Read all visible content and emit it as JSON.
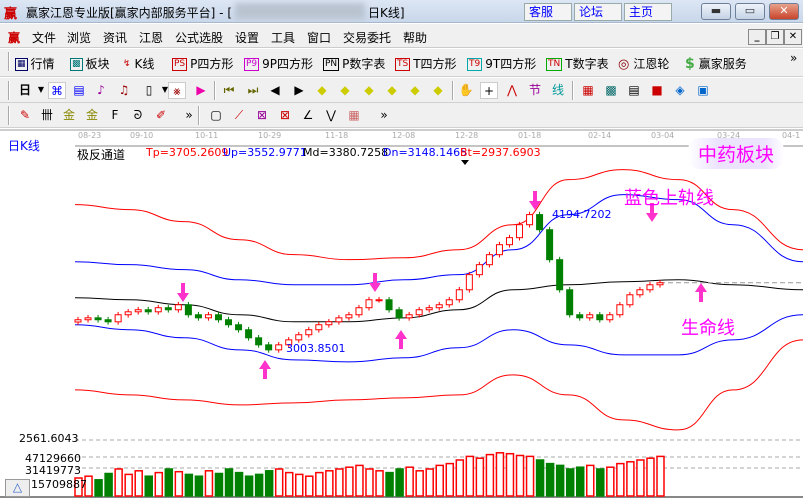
{
  "window": {
    "logo": "赢",
    "title": "赢家江恩专业版[赢家内部服务平台] - [",
    "title_tail": "日K线]",
    "links": [
      "客服",
      "论坛",
      "主页"
    ],
    "controls": [
      "minimize",
      "maximize",
      "close"
    ]
  },
  "menu": {
    "logo": "赢",
    "items": [
      "文件",
      "浏览",
      "资讯",
      "江恩",
      "公式选股",
      "设置",
      "工具",
      "窗口",
      "交易委托",
      "帮助"
    ]
  },
  "toolbar1": {
    "items": [
      {
        "icon": "quote-table-icon",
        "glyph": "▦",
        "label": "行情"
      },
      {
        "icon": "sector-icon",
        "glyph": "▩",
        "label": "板块"
      },
      {
        "icon": "candlestick-icon",
        "glyph": "↯",
        "label": "K线"
      },
      {
        "icon": "ps-icon",
        "glyph": "PS",
        "label": "P四方形"
      },
      {
        "icon": "p9-icon",
        "glyph": "P9",
        "label": "9P四方形"
      },
      {
        "icon": "pn-icon",
        "glyph": "PN",
        "label": "P数字表"
      },
      {
        "icon": "ts-icon",
        "glyph": "TS",
        "label": "T四方形"
      },
      {
        "icon": "t9-icon",
        "glyph": "T9",
        "label": "9T四方形"
      },
      {
        "icon": "tn-icon",
        "glyph": "TN",
        "label": "T数字表"
      },
      {
        "icon": "gann-wheel-icon",
        "glyph": "◎",
        "label": "江恩轮"
      },
      {
        "icon": "dollar-icon",
        "glyph": "$",
        "label": "赢家服务"
      }
    ],
    "more": "»"
  },
  "toolbar2": {
    "period": "日",
    "more": "»"
  },
  "toolbar3": {
    "more": "»"
  },
  "chart": {
    "period_label": "日K线",
    "dates": [
      "08-23",
      "09-10",
      "10-11",
      "10-29",
      "11-18",
      "12-08",
      "12-28",
      "01-18",
      "02-14",
      "03-04",
      "03-24",
      "04-1"
    ],
    "indicator": {
      "name": "极反通道",
      "tp": "Tp=3705.2609",
      "up": "Up=3552.9771",
      "md": "Md=3380.7258",
      "dn": "Dn=3148.1465",
      "bt": "Bt=2937.6903"
    },
    "sector_badge": "中药板块",
    "annot_upper": "蓝色上轨线",
    "annot_life": "生命线",
    "high_label": "4194.7202",
    "low_label": "3003.8501",
    "volume_labels": [
      "2561.6043",
      "47129660",
      "31419773",
      "15709887"
    ],
    "volume_button": "△",
    "colors": {
      "up": "#ff0000",
      "down": "#008000",
      "tp": "#ff0000",
      "upper": "#0000ff",
      "mid": "#000000",
      "arrow": "#ff33cc"
    }
  },
  "chart_data": {
    "type": "line",
    "ylim": [
      2280,
      4790
    ],
    "line_x_fraction": [
      0,
      0.075,
      0.15,
      0.226,
      0.301,
      0.376,
      0.452,
      0.527,
      0.602,
      0.678,
      0.753,
      0.829,
      0.904,
      1
    ],
    "series": [
      {
        "name": "Tp",
        "values": [
          4265,
          4221,
          4115,
          3956,
          3824,
          3780,
          3797,
          3868,
          4088,
          4485,
          4573,
          4485,
          4221,
          3868
        ]
      },
      {
        "name": "Up",
        "values": [
          3762,
          3736,
          3692,
          3603,
          3559,
          3559,
          3603,
          3648,
          3868,
          4177,
          4353,
          4309,
          4088,
          3762
        ]
      },
      {
        "name": "Md",
        "values": [
          3445,
          3427,
          3383,
          3295,
          3233,
          3233,
          3268,
          3339,
          3515,
          3559,
          3586,
          3603,
          3559,
          3515
        ]
      },
      {
        "name": "Dn",
        "values": [
          3207,
          3163,
          3092,
          2986,
          2898,
          2880,
          2916,
          3004,
          3163,
          3030,
          2942,
          2942,
          3074,
          3295
        ]
      },
      {
        "name": "Bt",
        "values": [
          2633,
          2589,
          2545,
          2501,
          2519,
          2545,
          2563,
          2589,
          2766,
          2589,
          2369,
          2281,
          2633,
          3074
        ]
      }
    ],
    "closes": [
      3251,
      3268,
      3251,
      3233,
      3295,
      3321,
      3339,
      3321,
      3357,
      3339,
      3383,
      3295,
      3268,
      3295,
      3251,
      3207,
      3163,
      3092,
      3030,
      2986,
      3030,
      3074,
      3119,
      3163,
      3207,
      3233,
      3268,
      3295,
      3357,
      3427,
      3427,
      3339,
      3268,
      3295,
      3339,
      3357,
      3383,
      3427,
      3515,
      3648,
      3736,
      3824,
      3912,
      3974,
      4088,
      4177,
      4044,
      3780,
      3515,
      3295,
      3268,
      3295,
      3251,
      3295,
      3383,
      3471,
      3515,
      3559,
      3577
    ],
    "volumes": [
      20,
      22,
      18,
      25,
      30,
      24,
      28,
      22,
      26,
      30,
      27,
      24,
      22,
      28,
      25,
      30,
      26,
      22,
      24,
      28,
      30,
      26,
      24,
      22,
      26,
      28,
      30,
      32,
      34,
      30,
      28,
      26,
      30,
      32,
      28,
      30,
      34,
      36,
      40,
      44,
      42,
      46,
      48,
      47,
      45,
      44,
      40,
      36,
      34,
      30,
      32,
      34,
      30,
      32,
      36,
      38,
      40,
      42,
      44
    ]
  }
}
